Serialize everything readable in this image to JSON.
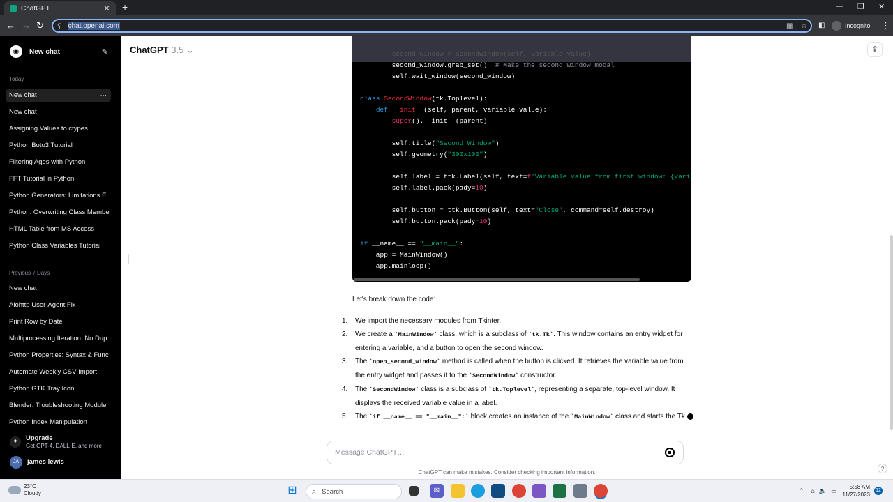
{
  "browser": {
    "tab_title": "ChatGPT",
    "new_tab": "+",
    "url": "chat.openai.com",
    "incognito": "Incognito"
  },
  "sidebar": {
    "new_chat": "New chat",
    "today_label": "Today",
    "today_items": [
      "New chat",
      "New chat",
      "Assigning Values to ctypes",
      "Python Boto3 Tutorial",
      "Filtering Ages with Python",
      "FFT Tutorial in Python",
      "Python Generators: Limitations E",
      "Python: Overwriting Class Membe",
      "HTML Table from MS Access",
      "Python Class Variables Tutorial"
    ],
    "prev7_label": "Previous 7 Days",
    "prev7_items": [
      "New chat",
      "Aiohttp User-Agent Fix",
      "Print Row by Date",
      "Multiprocessing Iteration: No Dup",
      "Python Properties: Syntax & Func",
      "Automate Weekly CSV Import",
      "Python GTK Tray Icon",
      "Blender: Troubleshooting Module",
      "Python Index Manipulation"
    ],
    "upgrade_title": "Upgrade",
    "upgrade_sub": "Get GPT-4, DALL·E, and more",
    "user_initials": "JA",
    "user_name": "james lewis"
  },
  "header": {
    "model": "ChatGPT",
    "version": "3.5"
  },
  "code_lines": {
    "l0": "second_window = SecondWindow(self, variable_value)",
    "l1": "second_window.grab_set()",
    "l1c": "# Make the second window modal",
    "l2": "self.wait_window(second_window)"
  },
  "prose": {
    "intro": "Let's break down the code:",
    "items": [
      "We import the necessary modules from Tkinter.",
      "We create a",
      "The",
      "The",
      "The"
    ]
  },
  "composer": {
    "placeholder": "Message ChatGPT…",
    "disclaimer": "ChatGPT can make mistakes. Consider checking important information.",
    "help": "?"
  },
  "taskbar": {
    "temp": "23°C",
    "weather": "Cloudy",
    "search": "Search",
    "time": "5:58 AM",
    "date": "11/27/2023",
    "notif": "12"
  }
}
